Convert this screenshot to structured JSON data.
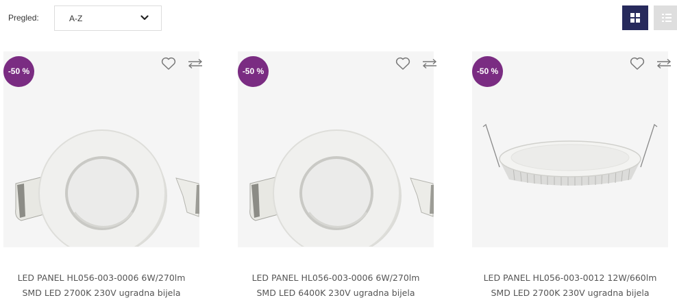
{
  "toolbar": {
    "sort_label": "Pregled:",
    "sort_value": "A-Z",
    "grid_view_icon": "grid-icon",
    "list_view_icon": "list-icon"
  },
  "colors": {
    "badge": "#7a2c82",
    "grid_active": "#272a5c",
    "list_inactive": "#dedede"
  },
  "products": [
    {
      "badge": "-50 %",
      "title_line1": "LED PANEL HL056-003-0006 6W/270lm",
      "title_line2": "SMD LED 2700K 230V ugradna bijela",
      "image": "round-led-panel-with-clips"
    },
    {
      "badge": "-50 %",
      "title_line1": "LED PANEL HL056-003-0006 6W/270lm",
      "title_line2": "SMD LED 6400K 230V ugradna bijela",
      "image": "round-led-panel-with-clips"
    },
    {
      "badge": "-50 %",
      "title_line1": "LED PANEL HL056-003-0012 12W/660lm",
      "title_line2": "SMD LED 2700K 230V ugradna bijela",
      "image": "slim-led-panel-side-view"
    }
  ]
}
